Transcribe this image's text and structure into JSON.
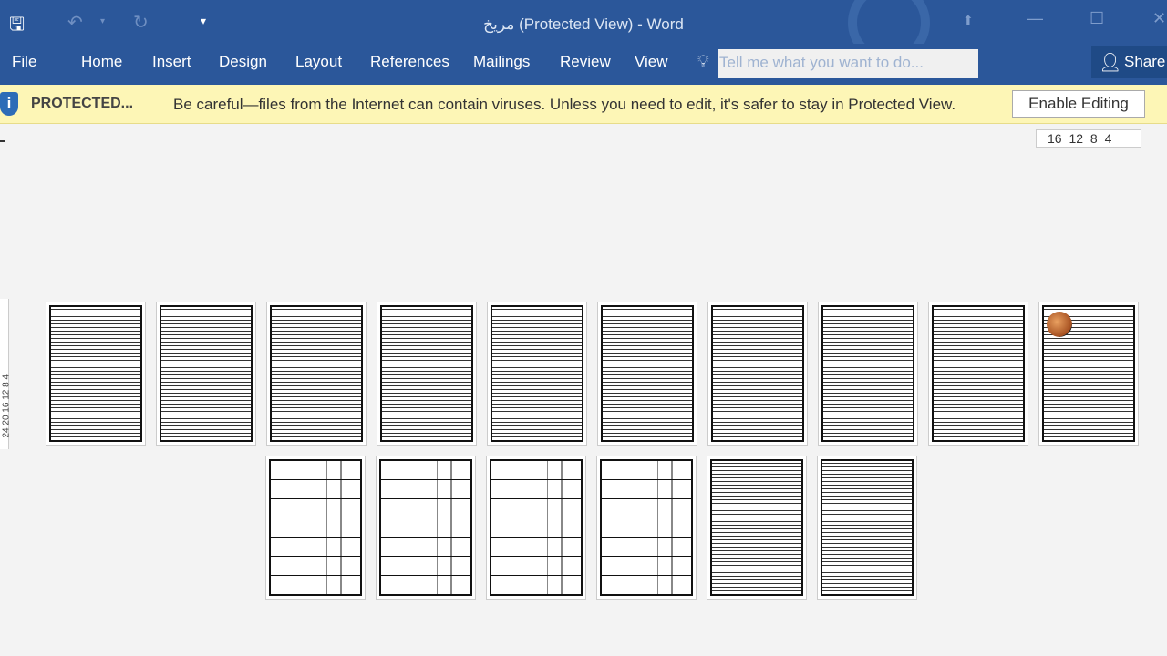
{
  "window": {
    "title": "مريخ (Protected View) - Word"
  },
  "quick_access": {
    "save": "save-icon",
    "undo": "undo-icon",
    "redo": "redo-icon",
    "customize": "▾"
  },
  "tabs": [
    "File",
    "Home",
    "Insert",
    "Design",
    "Layout",
    "References",
    "Mailings",
    "Review",
    "View"
  ],
  "tell_me": {
    "placeholder": "Tell me what you want to do..."
  },
  "share": "Share",
  "protected_bar": {
    "label": "PROTECTED...",
    "message": "Be careful—files from the Internet can contain viruses. Unless you need to edit, it's safer to stay in Protected View.",
    "button": "Enable Editing"
  },
  "ruler": {
    "horizontal": "16 12 8 4",
    "vertical": "24 20 16 12 8 4"
  },
  "pages": {
    "row1_count": 10,
    "row2_count": 6,
    "image_page": 10,
    "table_pages": [
      11,
      12,
      13,
      14
    ]
  }
}
